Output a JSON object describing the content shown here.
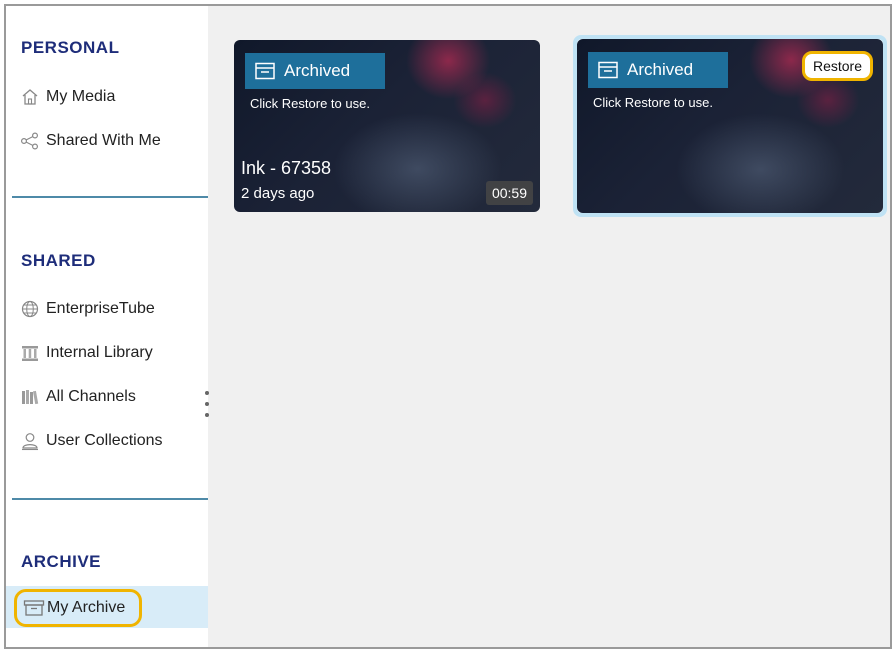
{
  "sidebar": {
    "personal": {
      "title": "PERSONAL",
      "items": [
        {
          "label": "My Media",
          "icon": "home-icon"
        },
        {
          "label": "Shared With Me",
          "icon": "share-icon"
        }
      ]
    },
    "shared": {
      "title": "SHARED",
      "items": [
        {
          "label": "EnterpriseTube",
          "icon": "globe-icon"
        },
        {
          "label": "Internal Library",
          "icon": "library-icon"
        },
        {
          "label": "All Channels",
          "icon": "books-icon"
        },
        {
          "label": "User Collections",
          "icon": "user-icon"
        }
      ]
    },
    "archive": {
      "title": "ARCHIVE",
      "items": [
        {
          "label": "My Archive",
          "icon": "archive-box-icon",
          "active": true
        }
      ]
    }
  },
  "cards": [
    {
      "badge": "Archived",
      "hint": "Click Restore to use.",
      "title": "Ink - 67358",
      "date": "2 days ago",
      "duration": "00:59"
    },
    {
      "badge": "Archived",
      "hint": "Click Restore to use.",
      "restore_label": "Restore"
    }
  ],
  "colors": {
    "section_title": "#1e2d7a",
    "badge_bg": "#1e6f9b",
    "highlight": "#f0b400",
    "active_bg": "#d8ecf8",
    "divider": "#4e8aa8"
  }
}
